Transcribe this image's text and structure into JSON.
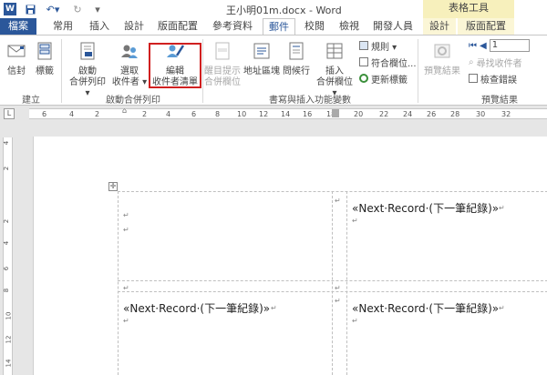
{
  "window": {
    "title": "王小明01m.docx - Word",
    "context_group": "表格工具"
  },
  "tabs": {
    "file": "檔案",
    "home": "常用",
    "insert": "插入",
    "design": "設計",
    "layout": "版面配置",
    "references": "參考資料",
    "mailings": "郵件",
    "review": "校閱",
    "view": "檢視",
    "developer": "開發人員",
    "table_design": "設計",
    "table_layout": "版面配置"
  },
  "ribbon": {
    "create": {
      "envelopes": "信封",
      "labels": "標籤",
      "group": "建立"
    },
    "start_merge": {
      "start_line1": "啟動",
      "start_line2": "合併列印 ▾",
      "select_line1": "選取",
      "select_line2": "收件者 ▾",
      "edit_line1": "編輯",
      "edit_line2": "收件者清單",
      "group": "啟動合併列印"
    },
    "write_insert": {
      "highlight_line1": "醒目提示",
      "highlight_line2": "合併欄位",
      "address_block": "地址區塊",
      "greeting_line": "問候行",
      "insert_field_line1": "插入",
      "insert_field_line2": "合併欄位 ▾",
      "rules": "規則 ▾",
      "match_fields": "符合欄位...",
      "update_labels": "更新標籤",
      "group": "書寫與插入功能變數"
    },
    "preview": {
      "preview_results": "預覽結果",
      "record_number": "1",
      "find_recipient": "尋找收件者",
      "check_errors": "檢查錯誤",
      "group": "預覽結果"
    }
  },
  "ruler": {
    "corner": "L",
    "numbers": [
      "6",
      "4",
      "2",
      "2",
      "4",
      "6",
      "8",
      "10",
      "12",
      "14",
      "16",
      "18",
      "20",
      "22",
      "24",
      "26",
      "28",
      "30",
      "32"
    ],
    "vnumbers": [
      "4",
      "2",
      "2",
      "4",
      "6",
      "8",
      "10",
      "12",
      "14"
    ]
  },
  "document": {
    "next_record": "«Next·Record·(下一筆紀錄)»",
    "para_mark": "↵"
  },
  "colors": {
    "accent": "#2b579a",
    "highlight_box": "#d02020",
    "context_tab": "#f7f0bc"
  }
}
